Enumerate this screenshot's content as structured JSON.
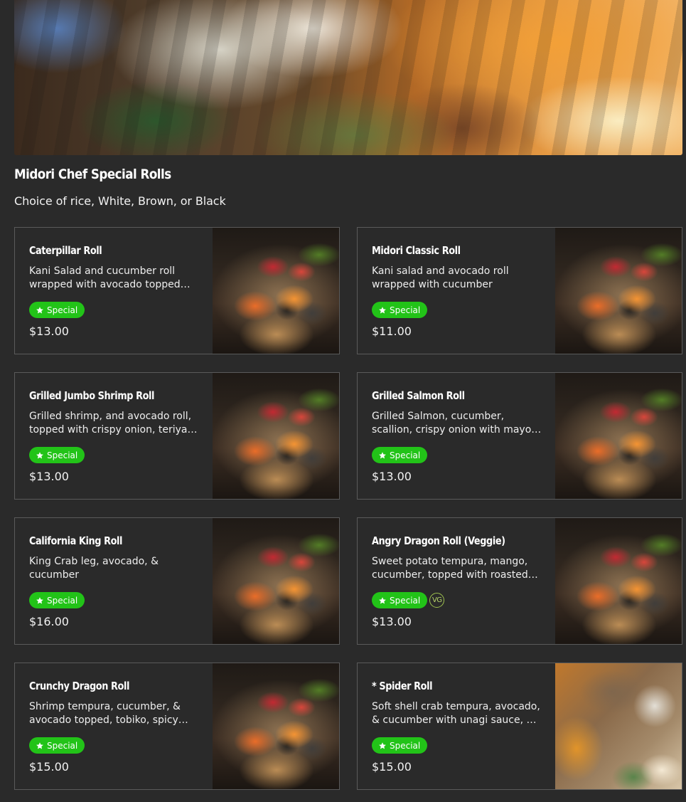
{
  "section": {
    "title": "Midori Chef Special Rolls",
    "subtitle": "Choice of rice, White, Brown, or Black"
  },
  "badge_label": "Special",
  "items": [
    {
      "name": "Caterpillar Roll",
      "description": "Kani Salad and cucumber roll wrapped with avocado topped with eel sauce",
      "price": "$13.00",
      "badges": [
        "Special"
      ],
      "image": "sushi-platter-photo"
    },
    {
      "name": "Midori Classic Roll",
      "description": "Kani salad and avocado roll wrapped with cucumber",
      "price": "$11.00",
      "badges": [
        "Special"
      ],
      "image": "sushi-platter-photo"
    },
    {
      "name": "Grilled Jumbo Shrimp Roll",
      "description": "Grilled shrimp, and avocado roll, topped with crispy onion, teriyaki sauce",
      "price": "$13.00",
      "badges": [
        "Special"
      ],
      "image": "sushi-platter-photo"
    },
    {
      "name": "Grilled Salmon Roll",
      "description": "Grilled Salmon, cucumber, scallion, crispy onion with mayo, & teriyaki sauce",
      "price": "$13.00",
      "badges": [
        "Special"
      ],
      "image": "sushi-platter-photo"
    },
    {
      "name": "California King Roll",
      "description": "King Crab leg, avocado, & cucumber",
      "price": "$16.00",
      "badges": [
        "Special"
      ],
      "image": "sushi-platter-photo"
    },
    {
      "name": "Angry Dragon Roll (Veggie)",
      "description": "Sweet potato tempura, mango, cucumber, topped with roasted red pepper",
      "price": "$13.00",
      "badges": [
        "Special"
      ],
      "vg": "VG",
      "image": "sushi-platter-photo"
    },
    {
      "name": "Crunchy Dragon Roll",
      "description": "Shrimp tempura, cucumber, & avocado topped, tobiko, spicy mayo & eel sauce",
      "price": "$15.00",
      "badges": [
        "Special"
      ],
      "image": "sushi-platter-photo"
    },
    {
      "name": "* Spider Roll",
      "description": "Soft shell crab tempura, avocado, & cucumber with unagi sauce, & * spicy mayo",
      "price": "$15.00",
      "badges": [
        "Special"
      ],
      "image": "sushi-roll-photo-alt"
    }
  ],
  "icons": {
    "badge": "star-icon",
    "vegetarian": "vegetarian-icon"
  },
  "colors": {
    "background": "#2a2a2a",
    "badge_green": "#22c318",
    "card_border": "#5a5a5a",
    "vg_outline": "#9ec24e"
  }
}
